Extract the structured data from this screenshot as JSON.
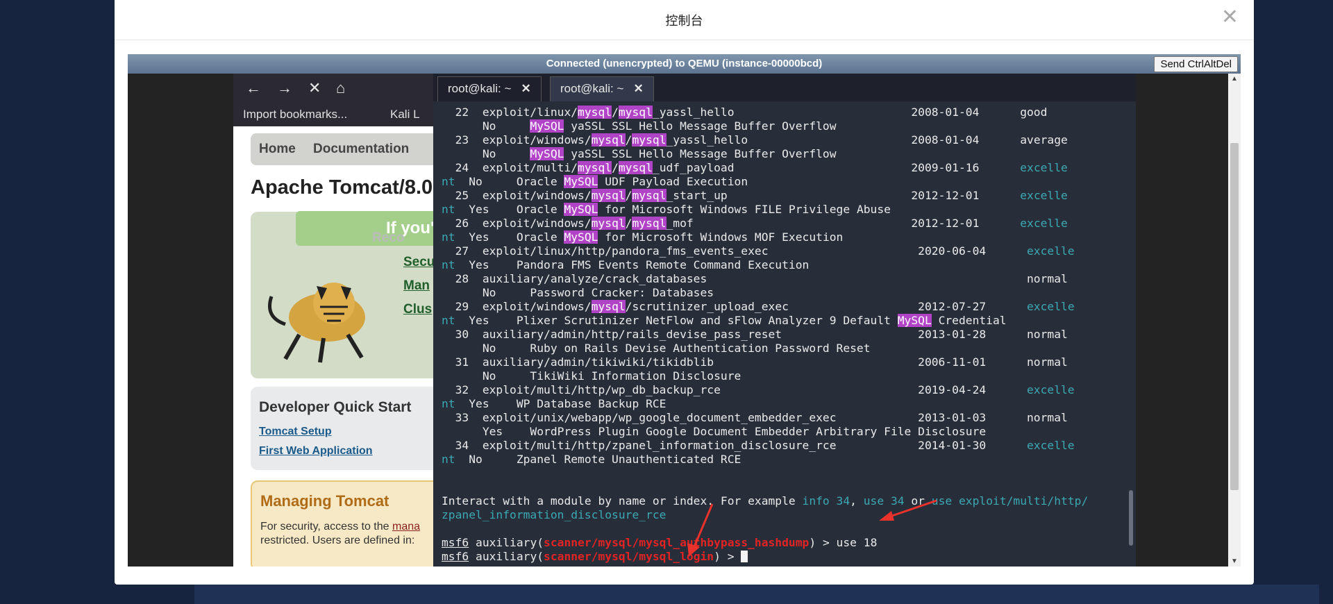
{
  "modal": {
    "title": "控制台",
    "close_label": "✕"
  },
  "vnc": {
    "status": "Connected (unencrypted) to QEMU (instance-00000bcd)",
    "ctrl_alt_del": "Send CtrlAltDel"
  },
  "browser": {
    "bookmarks": [
      "Import bookmarks...",
      "Kali L"
    ],
    "tomcat_menu": [
      "Home",
      "Documentation"
    ],
    "tomcat_title": "Apache Tomcat/8.0",
    "green_banner": "If you'",
    "recommended": "Reco",
    "links": [
      "Secu",
      "Man",
      "Clus"
    ],
    "dev_title": "Developer Quick Start",
    "dev_links": [
      "Tomcat Setup",
      "First Web Application"
    ],
    "manage_title": "Managing Tomcat",
    "manage_text_1": "For security, access to the",
    "manage_link": "mana",
    "manage_text_2": "restricted. Users are defined in:"
  },
  "terminal": {
    "tabs": [
      "root@kali: ~",
      "root@kali: ~"
    ],
    "interact_prefix": "Interact with a module by name or index. For example ",
    "interact_ex1": "info 34",
    "interact_mid1": ", ",
    "interact_ex2": "use 34",
    "interact_mid2": " or ",
    "interact_ex3": "use exploit/multi/http/",
    "interact_ex3_cont": "zpanel_information_disclosure_rce",
    "prompt1_a": "msf6",
    "prompt1_b": " auxiliary(",
    "prompt1_mod": "scanner/mysql/mysql_authbypass_hashdump",
    "prompt1_c": ") > use 18",
    "prompt2_a": "msf6",
    "prompt2_b": " auxiliary(",
    "prompt2_mod": "scanner/mysql/mysql_login",
    "prompt2_c": ") > "
  },
  "colors": {
    "highlight": "#b043c6",
    "cyan": "#3ba9b3",
    "red": "#e02424",
    "arrow": "#e8322b"
  }
}
